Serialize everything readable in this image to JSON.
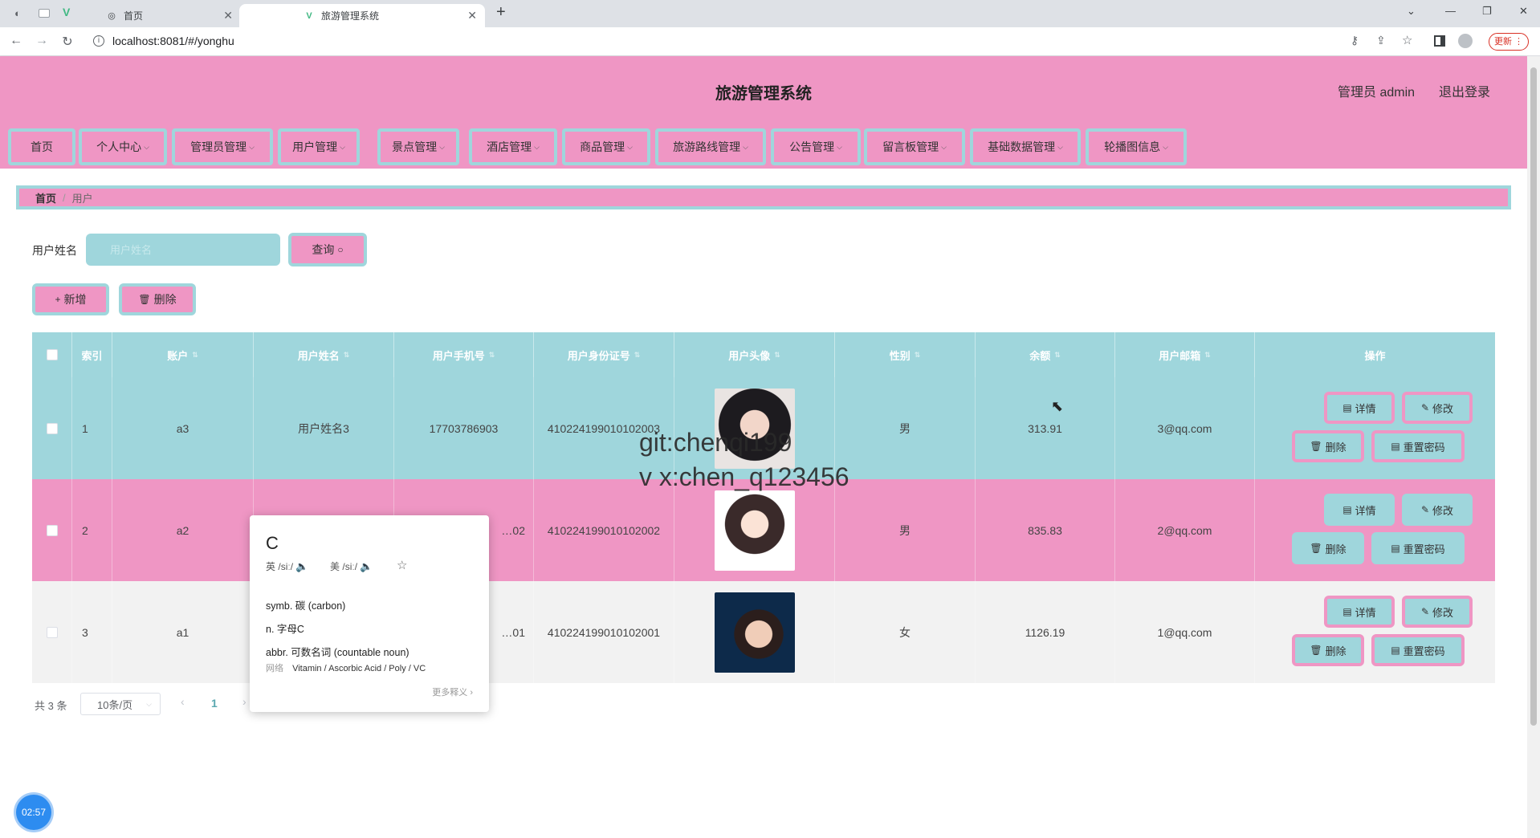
{
  "browser": {
    "tabs": [
      {
        "title": "首页",
        "icon": "globe-icon"
      },
      {
        "title": "旅游管理系统",
        "icon": "vue-icon"
      }
    ],
    "url": "localhost:8081/#/yonghu",
    "update_label": "更新"
  },
  "header": {
    "title": "旅游管理系统",
    "admin_label": "管理员 admin",
    "logout_label": "退出登录",
    "background_color": "#ef96c4",
    "accent_color": "#9fd6dc"
  },
  "nav": {
    "items": [
      "首页",
      "个人中心",
      "管理员管理",
      "用户管理",
      "景点管理",
      "酒店管理",
      "商品管理",
      "旅游路线管理",
      "公告管理",
      "留言板管理",
      "基础数据管理",
      "轮播图信息"
    ]
  },
  "breadcrumb": {
    "home": "首页",
    "separator": "/",
    "current": "用户"
  },
  "search": {
    "label": "用户姓名",
    "placeholder": "用户姓名",
    "button_label": "查询"
  },
  "actions": {
    "add_label": "新增",
    "delete_label": "删除"
  },
  "table": {
    "headers": [
      "索引",
      "账户",
      "用户姓名",
      "用户手机号",
      "用户身份证号",
      "用户头像",
      "性别",
      "余额",
      "用户邮箱",
      "操作"
    ],
    "rows": [
      {
        "index": "1",
        "account": "a3",
        "name": "用户姓名3",
        "phone": "17703786903",
        "id_card": "410224199010102003",
        "gender": "男",
        "balance": "313.91",
        "email": "3@qq.com"
      },
      {
        "index": "2",
        "account": "a2",
        "name": "",
        "phone": "…02",
        "id_card": "410224199010102002",
        "gender": "男",
        "balance": "835.83",
        "email": "2@qq.com"
      },
      {
        "index": "3",
        "account": "a1",
        "name": "",
        "phone": "…01",
        "id_card": "410224199010102001",
        "gender": "女",
        "balance": "1126.19",
        "email": "1@qq.com"
      }
    ],
    "row_actions": {
      "detail": "详情",
      "edit": "修改",
      "delete": "删除",
      "reset": "重置密码"
    }
  },
  "pagination": {
    "total": "共 3 条",
    "page_size": "10条/页",
    "current_page": "1"
  },
  "watermark": {
    "line1": "git:chenqi199",
    "line2": "v x:chen_q123456"
  },
  "dictionary": {
    "word": "C",
    "uk_label": "英",
    "uk_ipa": "/siː/",
    "us_label": "美",
    "us_ipa": "/siː/",
    "defs": [
      "symb. 碳 (carbon)",
      "n. 字母C",
      "abbr. 可数名词 (countable noun)"
    ],
    "web_label": "网络",
    "web_text": "Vitamin / Ascorbic Acid / Poly / VC",
    "more_label": "更多释义 ›"
  },
  "timer": "02:57"
}
